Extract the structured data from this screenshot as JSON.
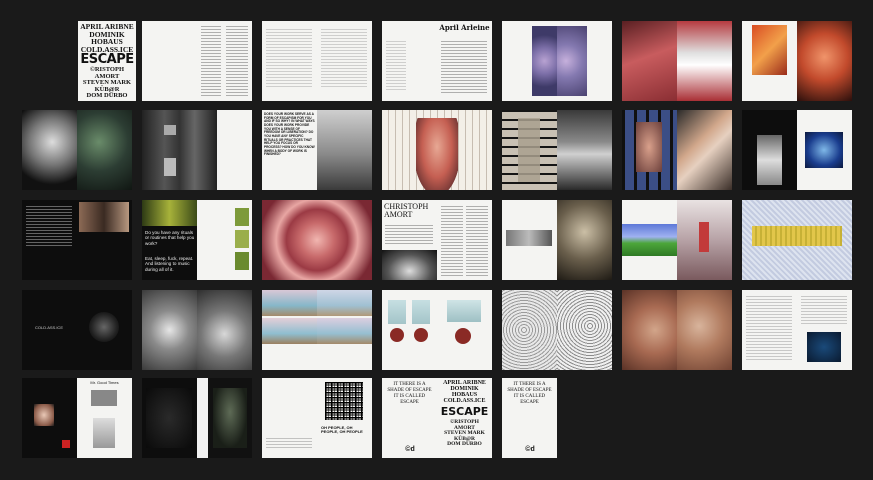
{
  "cover": {
    "names_top": [
      "APRIL ARIBNE",
      "DOMINIK",
      "HOBAUS",
      "COLD.ASS.ICE"
    ],
    "title": "ESCAPE",
    "names_bottom": [
      "©RISTOPH",
      "AMORT",
      "STEVEN MARK",
      "KÜB@R",
      "DOM DURBO"
    ]
  },
  "spread_headings": {
    "april": "April Arleine",
    "christoph": "CHRISTOPH AMORT",
    "question": "Do you have any rituals or routines that help you work?",
    "answer": "Eat, sleep, fuck, repeat. And listening to music during all of it.",
    "qa_block": "DOES YOUR WORK SERVE AS A FORM OF ESCAPISM FOR YOU AND IF SO WHY? IN WHAT WAYS DOES YOUR WORK PROVIDE YOU WITH A SENSE OF FREEDOM OR LIBERATION? DO YOU HAVE ANY SPECIFIC RITUALS OR PRACTICES THAT HELP YOU FOCUS OR PROCESS? HOW DO YOU KNOW WHEN A BODY OF WORK IS FINISHED?",
    "dark_small": "COLD.ASS.ICE",
    "small_caption": "Mr. Good Times",
    "closing": "OH PEOPLE, OH PEOPLE, OH PEOPLE",
    "back_text": "IT THERE IS A SHADE OF ESCAPE IT IS CALLED ESCAPE",
    "logo": "©d"
  }
}
